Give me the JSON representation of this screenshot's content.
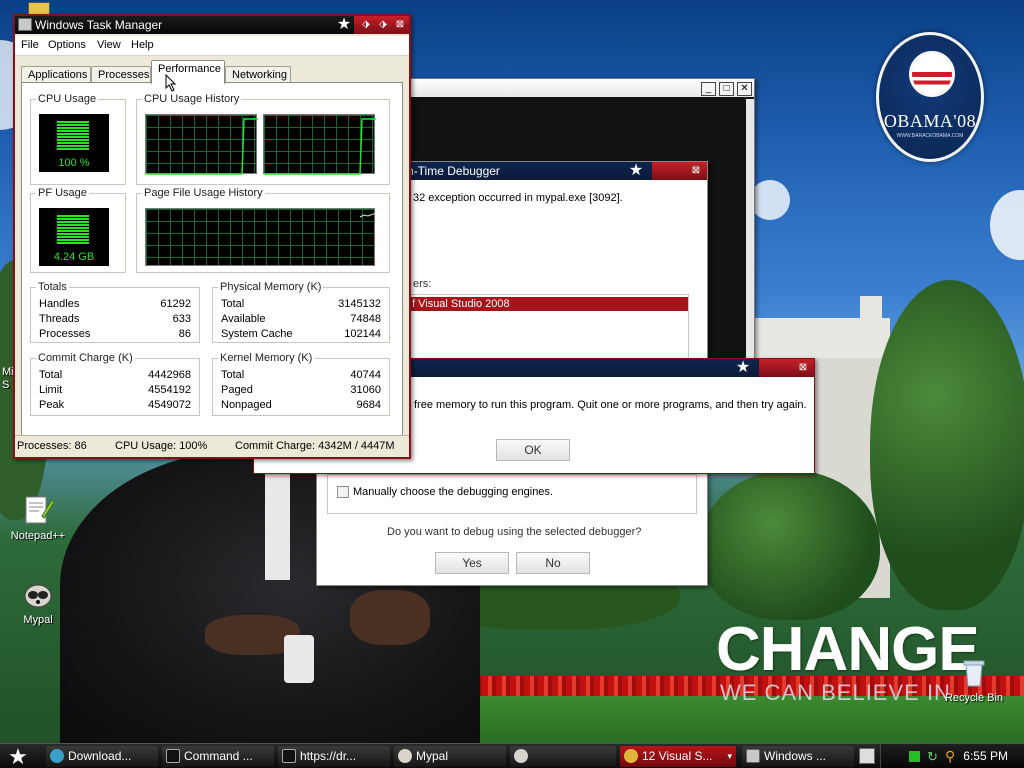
{
  "desktop": {
    "logo": {
      "title": "OBAMA'08",
      "subtitle": "WWW.BARACKOBAMA.COM"
    },
    "slogan": {
      "main": "CHANGE",
      "sub": "WE CAN BELIEVE IN"
    },
    "icons": [
      {
        "label": "Notepad++"
      },
      {
        "label": "Mypal"
      },
      {
        "label": "Recycle Bin"
      }
    ],
    "partial_left_label": "Mi S"
  },
  "task_manager": {
    "title": "Windows Task Manager",
    "menu": [
      "File",
      "Options",
      "View",
      "Help"
    ],
    "tabs": [
      "Applications",
      "Processes",
      "Performance",
      "Networking"
    ],
    "active_tab": "Performance",
    "cpu_usage": {
      "label": "CPU Usage",
      "value": "100 %",
      "percent": 100
    },
    "cpu_history": {
      "label": "CPU Usage History"
    },
    "pf_usage": {
      "label": "PF Usage",
      "value": "4.24 GB"
    },
    "pf_history": {
      "label": "Page File Usage History"
    },
    "totals": {
      "label": "Totals",
      "rows": [
        {
          "k": "Handles",
          "v": "61292"
        },
        {
          "k": "Threads",
          "v": "633"
        },
        {
          "k": "Processes",
          "v": "86"
        }
      ]
    },
    "physical_memory": {
      "label": "Physical Memory (K)",
      "rows": [
        {
          "k": "Total",
          "v": "3145132"
        },
        {
          "k": "Available",
          "v": "74848"
        },
        {
          "k": "System Cache",
          "v": "102144"
        }
      ]
    },
    "commit_charge": {
      "label": "Commit Charge (K)",
      "rows": [
        {
          "k": "Total",
          "v": "4442968"
        },
        {
          "k": "Limit",
          "v": "4554192"
        },
        {
          "k": "Peak",
          "v": "4549072"
        }
      ]
    },
    "kernel_memory": {
      "label": "Kernel Memory (K)",
      "rows": [
        {
          "k": "Total",
          "v": "40744"
        },
        {
          "k": "Paged",
          "v": "31060"
        },
        {
          "k": "Nonpaged",
          "v": "9684"
        }
      ]
    },
    "status": {
      "processes": "Processes: 86",
      "cpu": "CPU Usage: 100%",
      "commit": "Commit Charge: 4342M / 4447M"
    }
  },
  "jit_debugger": {
    "title": "n-Time Debugger",
    "message": "32 exception occurred in mypal.exe [3092].",
    "list_label": "ers:",
    "selected_item": "f Visual Studio 2008",
    "manual_checkbox": "Manually choose the debugging engines.",
    "question": "Do you want to debug using the selected debugger?",
    "yes": "Yes",
    "no": "No"
  },
  "memory_error": {
    "message": "free memory to run this program. Quit one or more programs, and then try again.",
    "ok": "OK"
  },
  "taskbar": {
    "tasks": [
      {
        "label": "Download..."
      },
      {
        "label": "Command ..."
      },
      {
        "label": "https://dr..."
      },
      {
        "label": "Mypal"
      },
      {
        "label": ""
      },
      {
        "label": "12 Visual S..."
      },
      {
        "label": "Windows ..."
      }
    ],
    "clock": "6:55 PM"
  },
  "colors": {
    "accent_red": "#a5161c",
    "meter_green": "#2be02b",
    "graph_grid": "#0b6b2e"
  }
}
